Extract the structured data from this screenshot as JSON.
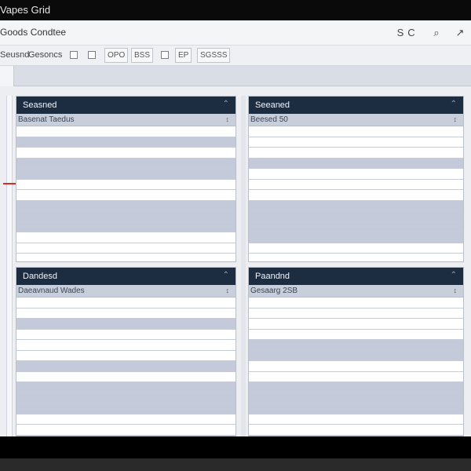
{
  "window": {
    "title": "Vapes Grid"
  },
  "header": {
    "app_title": "Goods Condtee",
    "icons": [
      "settings-icon",
      "refresh-icon",
      "search-icon",
      "share-icon"
    ],
    "icon_glyphs": [
      "S",
      "C",
      "⌕",
      "↗"
    ]
  },
  "toolbar": {
    "label_1": "Seusnd",
    "label_2": "Gesoncs",
    "btn_1": "OPO",
    "btn_2": "BSS",
    "btn_3": "EP",
    "btn_4": "SGSSS"
  },
  "panels": [
    {
      "title": "Seasned",
      "subtitle": "Basenat Taedus",
      "pin": "⌃",
      "sort": "↕",
      "pattern": [
        0,
        1,
        0,
        1,
        1,
        0,
        0,
        1,
        1,
        1,
        0,
        0,
        0,
        0
      ]
    },
    {
      "title": "Seeaned",
      "subtitle": "Beesed 50",
      "pin": "⌃",
      "sort": "↕",
      "pattern": [
        0,
        0,
        0,
        1,
        0,
        0,
        0,
        1,
        1,
        1,
        1,
        0,
        0,
        0
      ]
    },
    {
      "title": "Dandesd",
      "subtitle": "Daeavnaud Wades",
      "pin": "⌃",
      "sort": "↕",
      "pattern": [
        0,
        0,
        1,
        0,
        0,
        0,
        1,
        0,
        1,
        1,
        1,
        0,
        0,
        0
      ]
    },
    {
      "title": "Paandnd",
      "subtitle": "Gesaarg 2SB",
      "pin": "⌃",
      "sort": "↕",
      "pattern": [
        0,
        0,
        0,
        0,
        1,
        1,
        0,
        0,
        1,
        1,
        1,
        0,
        0,
        0
      ]
    }
  ]
}
